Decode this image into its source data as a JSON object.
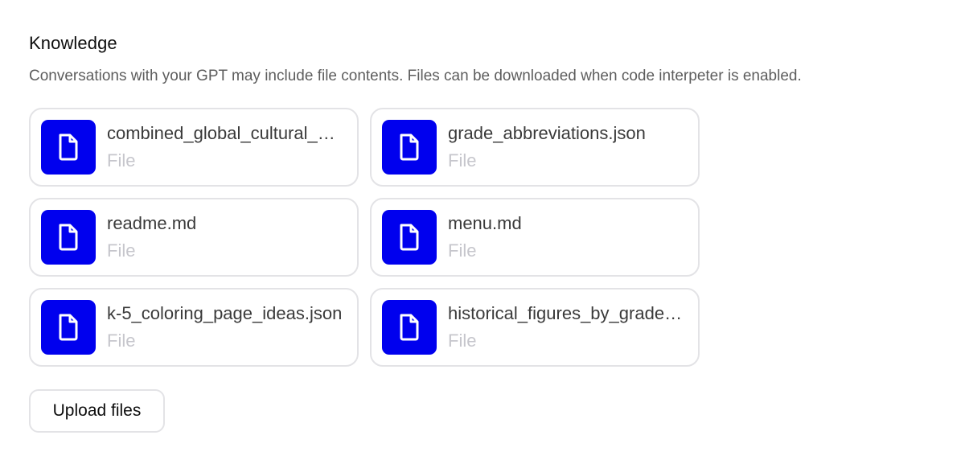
{
  "knowledge": {
    "title": "Knowledge",
    "description": "Conversations with your GPT may include file contents. Files can be downloaded when code interpeter is enabled.",
    "files": [
      {
        "name": "combined_global_cultural_calendar.json",
        "type": "File",
        "icon": "file-icon"
      },
      {
        "name": "grade_abbreviations.json",
        "type": "File",
        "icon": "file-icon"
      },
      {
        "name": "readme.md",
        "type": "File",
        "icon": "file-icon"
      },
      {
        "name": "menu.md",
        "type": "File",
        "icon": "file-icon"
      },
      {
        "name": "k-5_coloring_page_ideas.json",
        "type": "File",
        "icon": "file-icon"
      },
      {
        "name": "historical_figures_by_grade.json",
        "type": "File",
        "icon": "file-icon"
      }
    ],
    "upload_label": "Upload files"
  },
  "colors": {
    "icon_background": "#0000ee",
    "card_border": "#e3e3e6",
    "muted_text": "#c6c6cc",
    "description_text": "#5d5d5d"
  }
}
